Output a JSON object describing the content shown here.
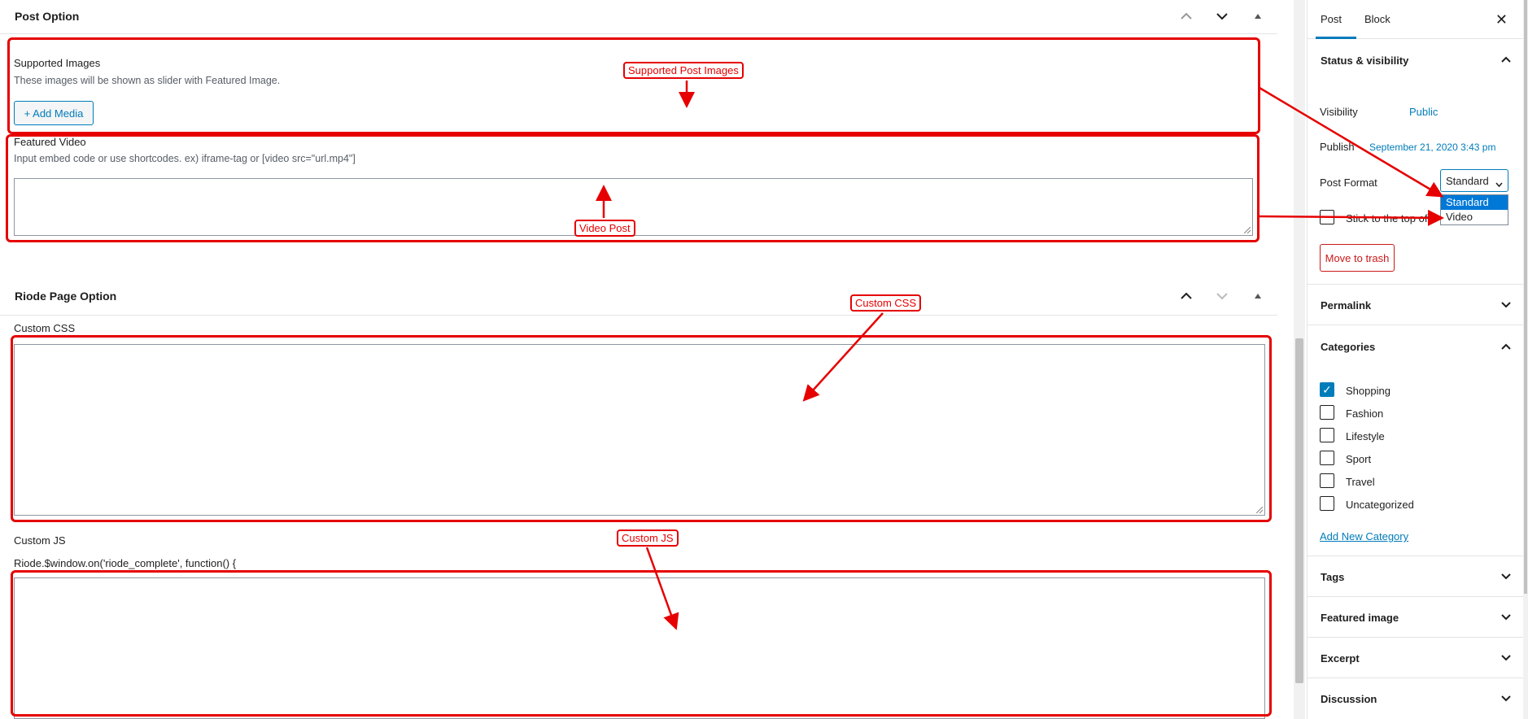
{
  "post_option": {
    "title": "Post Option",
    "supported_images": {
      "label": "Supported Images",
      "description": "These images will be shown as slider with Featured Image.",
      "add_media_label": "+ Add Media"
    },
    "featured_video": {
      "label": "Featured Video",
      "description": "Input embed code or use shortcodes. ex) iframe-tag or [video src=\"url.mp4\"]"
    }
  },
  "page_option": {
    "title": "Riode Page Option",
    "custom_css_label": "Custom CSS",
    "custom_js_label": "Custom JS",
    "custom_js_prefix": "Riode.$window.on('riode_complete', function() {"
  },
  "annotations": {
    "supported_images": "Supported Post Images",
    "video_post": "Video Post",
    "custom_css": "Custom CSS",
    "custom_js": "Custom JS"
  },
  "sidebar": {
    "tabs": [
      "Post",
      "Block"
    ],
    "active_tab": "Post",
    "status": {
      "title": "Status & visibility",
      "visibility_label": "Visibility",
      "visibility_value": "Public",
      "publish_label": "Publish",
      "publish_value": "September 21, 2020 3:43 pm",
      "post_format_label": "Post Format",
      "post_format_selected": "Standard",
      "post_format_options": [
        "Standard",
        "Video"
      ],
      "stick_label": "Stick to the top of",
      "trash_label": "Move to trash"
    },
    "permalink_title": "Permalink",
    "categories": {
      "title": "Categories",
      "items": [
        {
          "label": "Shopping",
          "checked": true
        },
        {
          "label": "Fashion",
          "checked": false
        },
        {
          "label": "Lifestyle",
          "checked": false
        },
        {
          "label": "Sport",
          "checked": false
        },
        {
          "label": "Travel",
          "checked": false
        },
        {
          "label": "Uncategorized",
          "checked": false
        }
      ],
      "add_new_label": "Add New Category"
    },
    "tags_title": "Tags",
    "featured_image_title": "Featured image",
    "excerpt_title": "Excerpt",
    "discussion_title": "Discussion"
  },
  "colors": {
    "annotation": "#e60000",
    "accent": "#007cba",
    "danger": "#cc1818"
  }
}
